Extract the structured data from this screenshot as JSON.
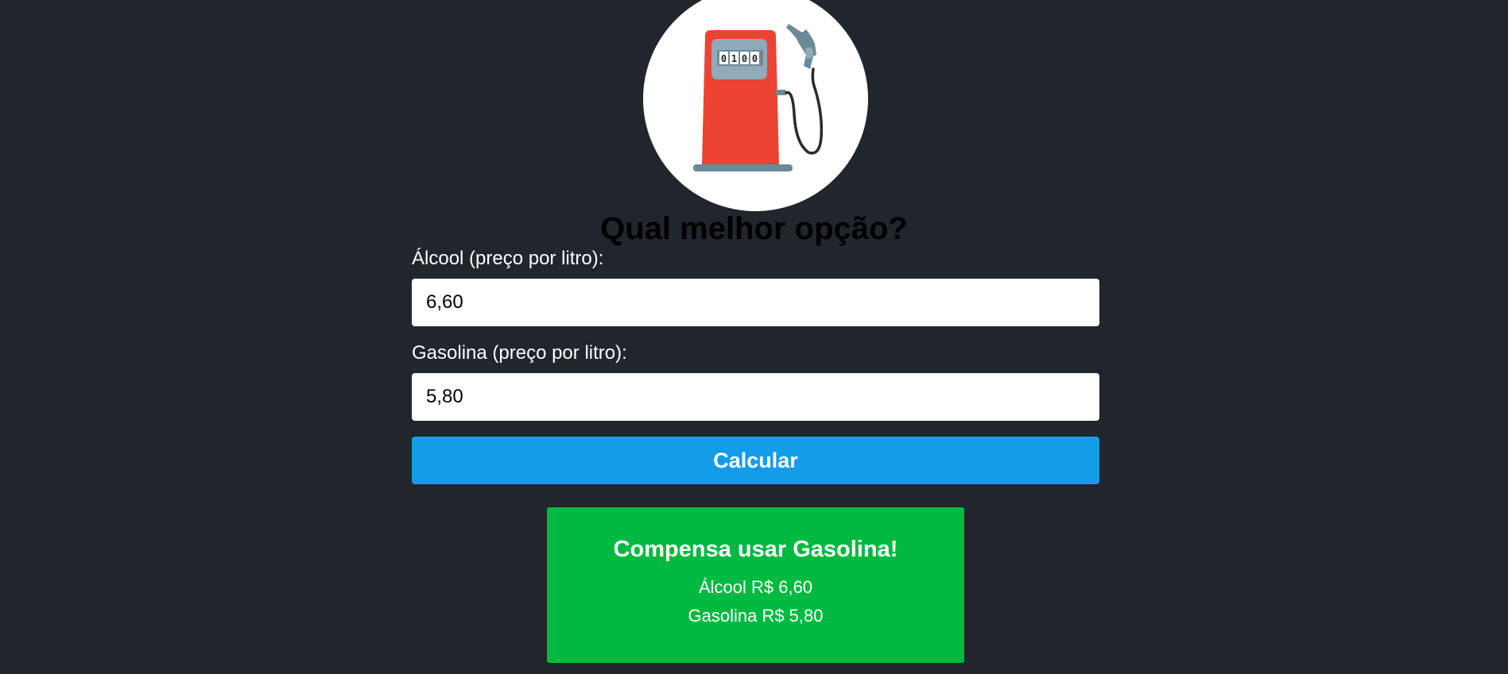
{
  "logo": {
    "icon": "fuel-pump-icon",
    "counter_digits": [
      "0",
      "1",
      "0",
      "0"
    ],
    "colors": {
      "circle": "#ffffff",
      "pump_body": "#ec4332",
      "pump_panel": "#8faab8",
      "nozzle": "#6b8a99",
      "hose": "#2b2b2b",
      "base": "#6b8a99"
    }
  },
  "page": {
    "title": "Qual melhor opção?",
    "background": "#21252c"
  },
  "form": {
    "alcool_label": "Álcool (preço por litro):",
    "alcool_value": "6,60",
    "gasolina_label": "Gasolina (preço por litro):",
    "gasolina_value": "5,80",
    "calculate_label": "Calcular",
    "button_color": "#139de9"
  },
  "result": {
    "title": "Compensa usar Gasolina!",
    "alcool_line": "Álcool R$ 6,60",
    "gasolina_line": "Gasolina R$ 5,80",
    "color": "#00b940"
  }
}
